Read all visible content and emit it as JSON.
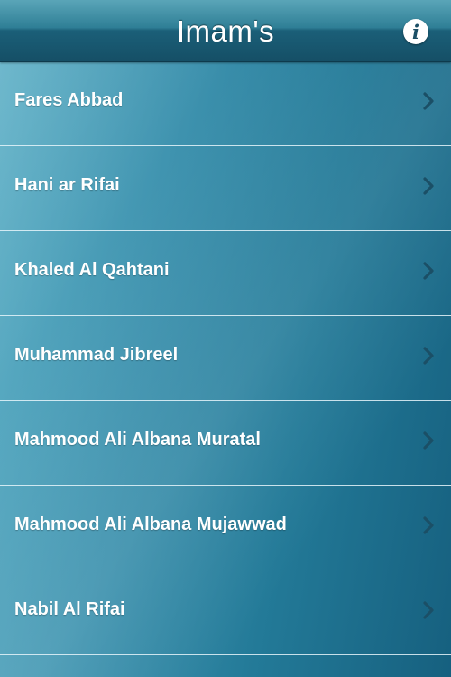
{
  "navbar": {
    "title": "Imam's",
    "info_label": "i",
    "info_icon": "info-icon"
  },
  "list": {
    "items": [
      {
        "label": "Fares Abbad",
        "icon": "chevron-right-icon"
      },
      {
        "label": "Hani ar Rifai",
        "icon": "chevron-right-icon"
      },
      {
        "label": "Khaled Al Qahtani",
        "icon": "chevron-right-icon"
      },
      {
        "label": "Muhammad Jibreel",
        "icon": "chevron-right-icon"
      },
      {
        "label": "Mahmood Ali Albana Muratal",
        "icon": "chevron-right-icon"
      },
      {
        "label": "Mahmood Ali Albana Mujawwad",
        "icon": "chevron-right-icon"
      },
      {
        "label": "Nabil Al Rifai",
        "icon": "chevron-right-icon"
      }
    ]
  },
  "colors": {
    "background_light": "#63b3c9",
    "background_dark": "#16607f",
    "navbar": "#1b5f78",
    "chevron": "#1b4f66",
    "separator": "#e6f5fa"
  }
}
